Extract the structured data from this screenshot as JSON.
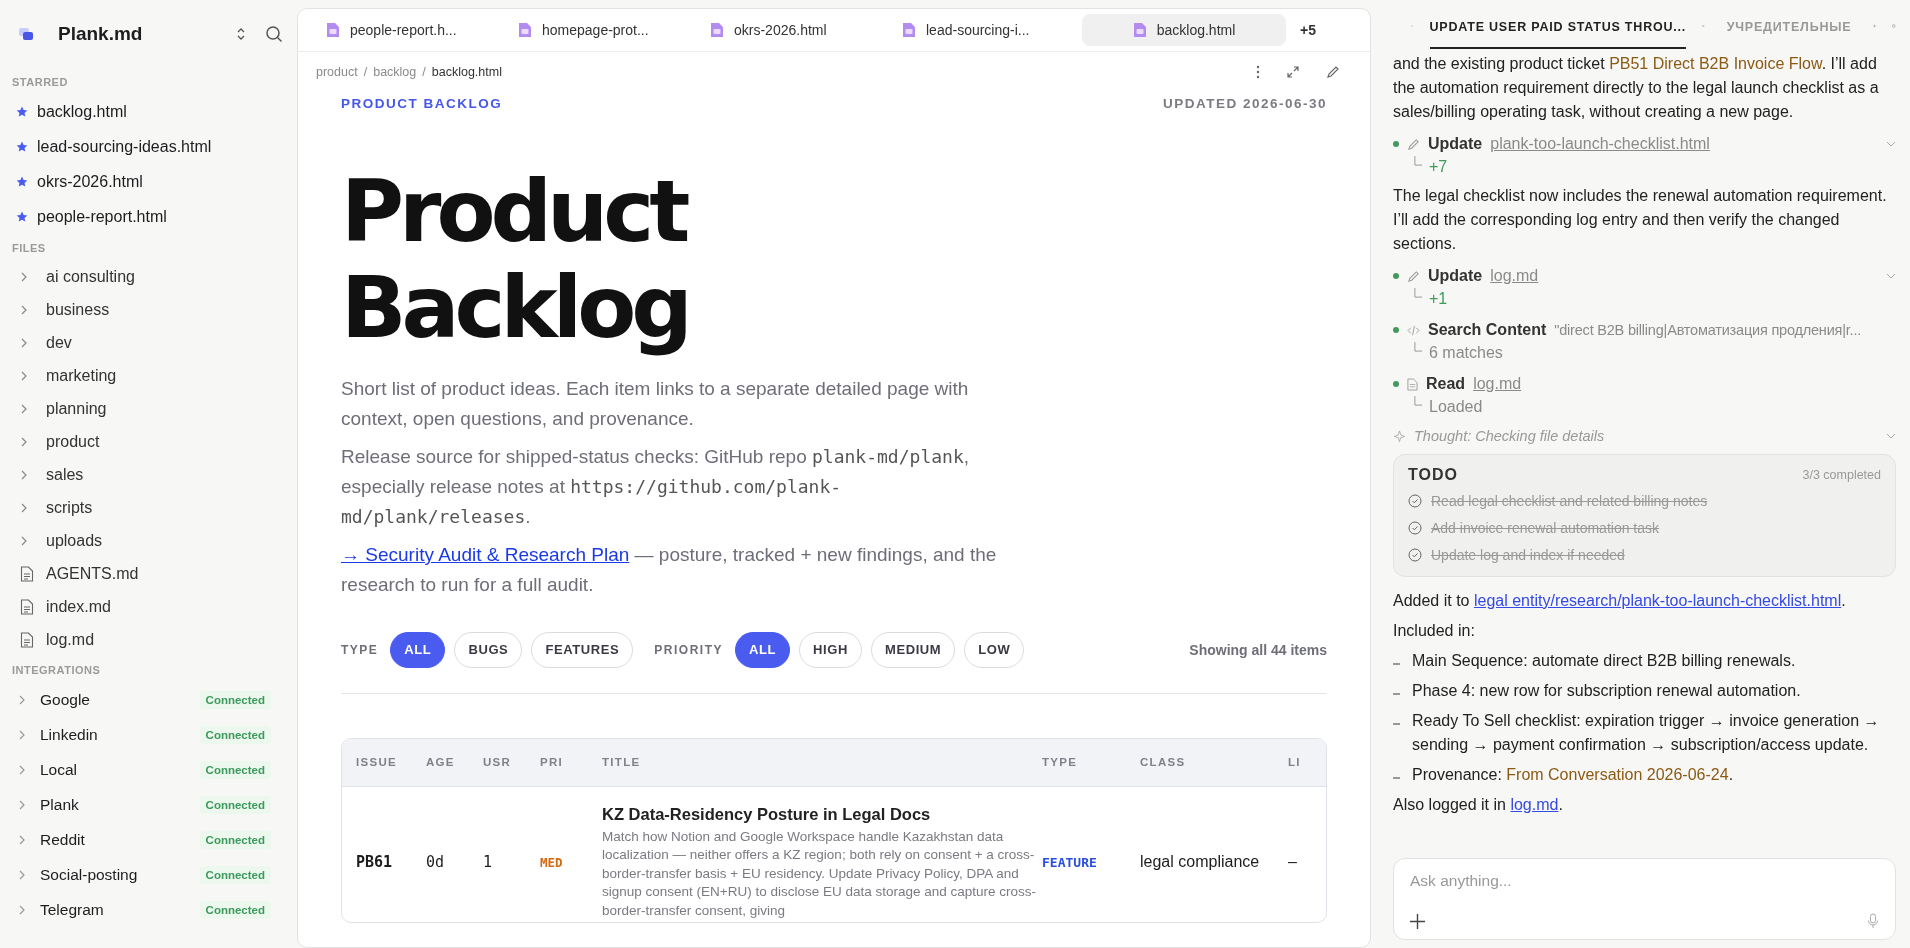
{
  "sidebar": {
    "workspace": "Plank.md",
    "starred": {
      "heading": "STARRED",
      "items": [
        "backlog.html",
        "lead-sourcing-ideas.html",
        "okrs-2026.html",
        "people-report.html"
      ]
    },
    "files": {
      "heading": "FILES",
      "items": [
        {
          "label": "ai consulting",
          "kind": "folder"
        },
        {
          "label": "business",
          "kind": "folder"
        },
        {
          "label": "dev",
          "kind": "folder"
        },
        {
          "label": "marketing",
          "kind": "folder"
        },
        {
          "label": "planning",
          "kind": "folder"
        },
        {
          "label": "product",
          "kind": "folder"
        },
        {
          "label": "sales",
          "kind": "folder"
        },
        {
          "label": "scripts",
          "kind": "folder"
        },
        {
          "label": "uploads",
          "kind": "folder"
        },
        {
          "label": "AGENTS.md",
          "kind": "file"
        },
        {
          "label": "index.md",
          "kind": "file"
        },
        {
          "label": "log.md",
          "kind": "file"
        }
      ]
    },
    "integrations": {
      "heading": "INTEGRATIONS",
      "items": [
        {
          "name": "Google",
          "status": "Connected"
        },
        {
          "name": "Linkedin",
          "status": "Connected"
        },
        {
          "name": "Local",
          "status": "Connected"
        },
        {
          "name": "Plank",
          "status": "Connected"
        },
        {
          "name": "Reddit",
          "status": "Connected"
        },
        {
          "name": "Social-posting",
          "status": "Connected"
        },
        {
          "name": "Telegram",
          "status": "Connected"
        }
      ]
    }
  },
  "tabs": [
    {
      "label": "people-report.h...",
      "selected": false
    },
    {
      "label": "homepage-prot...",
      "selected": false
    },
    {
      "label": "okrs-2026.html",
      "selected": false
    },
    {
      "label": "lead-sourcing-i...",
      "selected": false
    },
    {
      "label": "backlog.html",
      "selected": true
    }
  ],
  "more_tabs": "+5",
  "breadcrumb": {
    "separator": "/",
    "items": [
      "product",
      "backlog",
      "backlog.html"
    ]
  },
  "page": {
    "eyebrow": "PRODUCT BACKLOG",
    "updated": "UPDATED 2026-06-30",
    "title_lines": [
      "Product",
      "Backlog"
    ],
    "paragraphs": [
      [
        {
          "kind": "text",
          "text": "Short list of product ideas. Each item links to a separate detailed page with context, open questions, and provenance."
        }
      ],
      [
        {
          "kind": "text",
          "text": "Release source for shipped-status checks: GitHub repo "
        },
        {
          "kind": "code",
          "text": "plank-md/plank"
        },
        {
          "kind": "text",
          "text": ", especially release notes at "
        },
        {
          "kind": "code",
          "text": "https://github.com/plank-md/plank/releases"
        },
        {
          "kind": "text",
          "text": "."
        }
      ],
      [
        {
          "kind": "link",
          "text": "→ Security Audit & Research Plan"
        },
        {
          "kind": "text",
          "text": " — posture, tracked + new findings, and the research to run for a full audit."
        }
      ]
    ]
  },
  "filters": [
    {
      "label": "TYPE",
      "options": [
        {
          "label": "ALL",
          "selected": true
        },
        {
          "label": "BUGS",
          "selected": false
        },
        {
          "label": "FEATURES",
          "selected": false
        }
      ]
    },
    {
      "label": "PRIORITY",
      "options": [
        {
          "label": "ALL",
          "selected": true
        },
        {
          "label": "HIGH",
          "selected": false
        },
        {
          "label": "MEDIUM",
          "selected": false
        },
        {
          "label": "LOW",
          "selected": false
        }
      ]
    }
  ],
  "count": "Showing all 44 items",
  "table": {
    "columns": [
      "ISSUE",
      "AGE",
      "USR",
      "PRI",
      "TITLE",
      "TYPE",
      "CLASS",
      "LI"
    ],
    "rows": [
      {
        "issue": "PB61",
        "age": "0d",
        "usr": "1",
        "pri": "MED",
        "title": "KZ Data-Residency Posture in Legal Docs",
        "description": "Match how Notion and Google Workspace handle Kazakhstan data localization — neither offers a KZ region; both rely on consent + a cross-border-transfer basis + EU residency. Update Privacy Policy, DPA and signup consent (EN+RU) to disclose EU data storage and capture cross-border-transfer consent, giving",
        "type": "FEATURE",
        "class": "legal compliance",
        "column_8": "–"
      }
    ]
  },
  "chat": {
    "tabs": [
      {
        "label": "UPDATE USER PAID STATUS THROU...",
        "selected": true
      },
      {
        "label": "УЧРЕДИТЕЛЬНЫЕ",
        "selected": false
      }
    ],
    "messages": [
      {
        "kind": "text",
        "segments": [
          {
            "kind": "text",
            "text": "and the existing product ticket "
          },
          {
            "kind": "accent",
            "text": "PB51 Direct B2B Invoice Flow"
          },
          {
            "kind": "text",
            "text": ". I’ll add the automation requirement directly to the legal launch checklist as a sales/billing operating task, without creating a new page."
          }
        ]
      },
      {
        "kind": "edit",
        "verb": "Update",
        "target": "plank-too-launch-checklist.html",
        "result": "+7",
        "expandable": true
      },
      {
        "kind": "text",
        "segments": [
          {
            "kind": "text",
            "text": "The legal checklist now includes the renewal automation requirement. I’ll add the corresponding log entry and then verify the changed sections."
          }
        ]
      },
      {
        "kind": "edit",
        "verb": "Update",
        "target": "log.md",
        "result": "+1",
        "expandable": true
      },
      {
        "kind": "search",
        "verb": "Search Content",
        "target": "\"direct B2B billing|Автоматизация продления|r...",
        "result": "6 matches",
        "expandable": false
      },
      {
        "kind": "read",
        "verb": "Read",
        "target": "log.md",
        "result": "Loaded",
        "expandable": false
      },
      {
        "kind": "thought",
        "text": "Thought: Checking file details"
      },
      {
        "kind": "todo",
        "title": "TODO",
        "summary": "3/3 completed",
        "items": [
          {
            "label": "Read legal checklist and related billing notes",
            "done": true
          },
          {
            "label": "Add invoice renewal automation task",
            "done": true
          },
          {
            "label": "Update log and index if needed",
            "done": true
          }
        ]
      },
      {
        "kind": "text",
        "segments": [
          {
            "kind": "text",
            "text": "Added it to "
          },
          {
            "kind": "link",
            "text": "legal entity/research/plank-too-launch-checklist.html"
          },
          {
            "kind": "text",
            "text": "."
          }
        ]
      },
      {
        "kind": "text",
        "segments": [
          {
            "kind": "text",
            "text": "Included in:"
          }
        ]
      },
      {
        "kind": "list",
        "items": [
          [
            {
              "kind": "text",
              "text": "Main Sequence: automate direct B2B billing renewals."
            }
          ],
          [
            {
              "kind": "text",
              "text": "Phase 4: new row for subscription renewal automation."
            }
          ],
          [
            {
              "kind": "text",
              "text": "Ready To Sell checklist: expiration trigger → invoice generation → sending → payment confirmation → subscription/access update."
            }
          ],
          [
            {
              "kind": "text",
              "text": "Provenance: "
            },
            {
              "kind": "accent",
              "text": "From Conversation 2026-06-24"
            },
            {
              "kind": "text",
              "text": "."
            }
          ]
        ]
      },
      {
        "kind": "text",
        "segments": [
          {
            "kind": "text",
            "text": "Also logged it in "
          },
          {
            "kind": "link",
            "text": "log.md"
          },
          {
            "kind": "text",
            "text": "."
          }
        ]
      }
    ],
    "composer": {
      "placeholder": "Ask anything..."
    }
  }
}
